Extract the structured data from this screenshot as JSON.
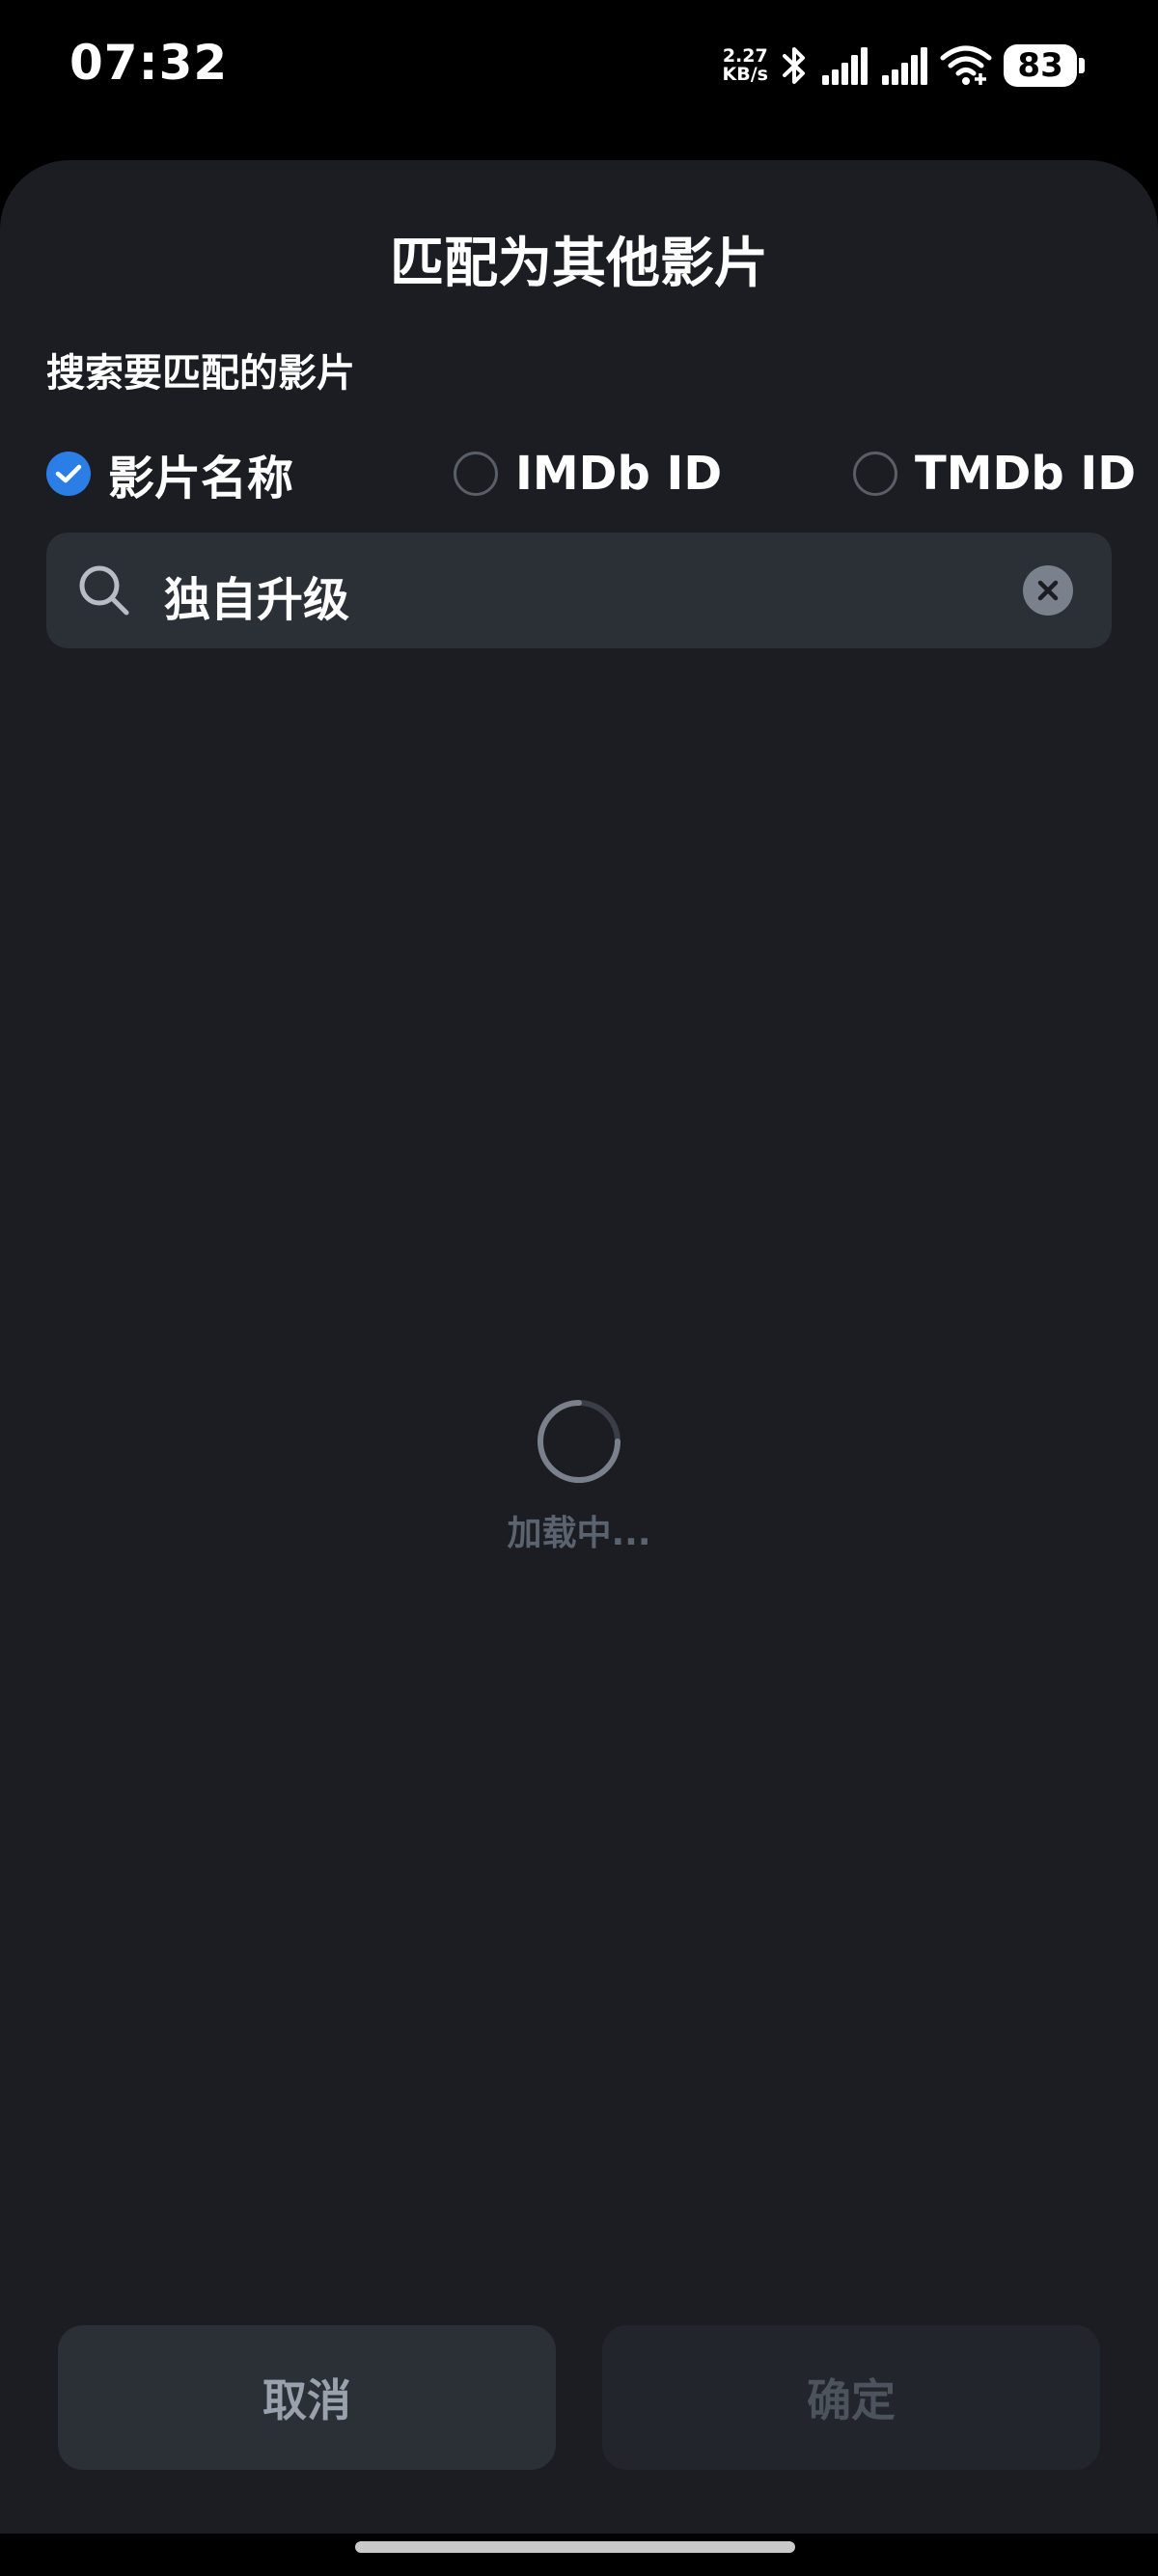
{
  "status_bar": {
    "time": "07:32",
    "net_speed_value": "2.27",
    "net_speed_unit": "KB/s",
    "battery_level": "83",
    "icons": [
      "bluetooth-icon",
      "signal-icon",
      "signal-icon",
      "wifi-icon",
      "battery-icon"
    ]
  },
  "dialog": {
    "title": "匹配为其他影片",
    "section_label": "搜索要匹配的影片",
    "search_types": [
      {
        "label": "影片名称",
        "selected": true
      },
      {
        "label": "IMDb ID",
        "selected": false
      },
      {
        "label": "TMDb ID",
        "selected": false
      }
    ],
    "search": {
      "value": "独自升级"
    },
    "loading_text": "加载中...",
    "buttons": {
      "cancel": "取消",
      "confirm": "确定"
    }
  },
  "colors": {
    "accent": "#2a7ee6",
    "sheet_background": "#1b1d22",
    "input_background": "#2b2f36"
  }
}
